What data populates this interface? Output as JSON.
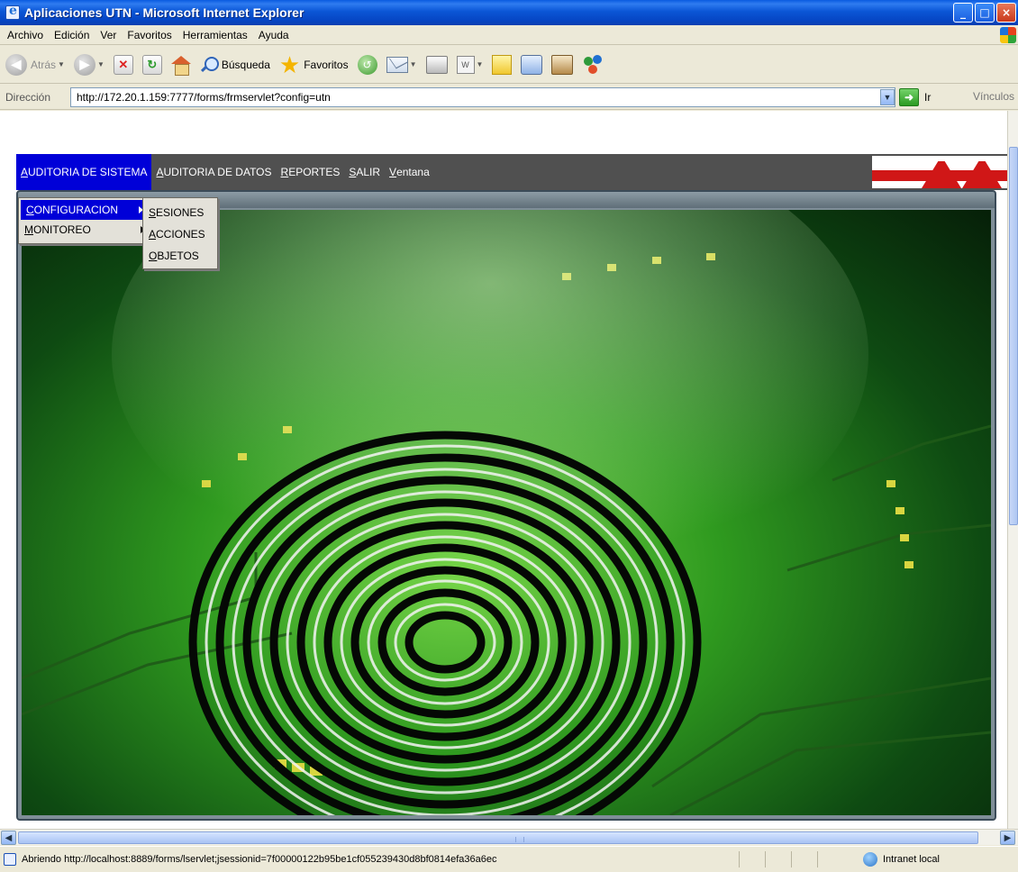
{
  "window": {
    "title": "Aplicaciones UTN - Microsoft Internet Explorer",
    "controls": {
      "minimize": "_",
      "maximize": "□",
      "close": "×"
    }
  },
  "menubar": {
    "items": [
      "Archivo",
      "Edición",
      "Ver",
      "Favoritos",
      "Herramientas",
      "Ayuda"
    ]
  },
  "toolbar": {
    "back_label": "Atrás",
    "search_label": "Búsqueda",
    "favorites_label": "Favoritos",
    "icons": [
      "back-icon",
      "forward-icon",
      "stop-icon",
      "refresh-icon",
      "home-icon",
      "search-icon",
      "favorites-star-icon",
      "media-icon",
      "mail-icon",
      "print-icon",
      "edit-icon",
      "notes-icon",
      "messenger-icon",
      "research-icon",
      "contacts-icon"
    ]
  },
  "address": {
    "label": "Dirección",
    "url": "http://172.20.1.159:7777/forms/frmservlet?config=utn",
    "go_label": "Ir",
    "links_label": "Vínculos"
  },
  "app_menu": {
    "items": [
      {
        "label": "AUDITORIA DE SISTEMA",
        "accel": "A",
        "rest": "UDITORIA DE SISTEMA"
      },
      {
        "label": "AUDITORIA DE DATOS",
        "accel": "A",
        "rest": "UDITORIA DE DATOS"
      },
      {
        "label": "REPORTES",
        "accel": "R",
        "rest": "EPORTES"
      },
      {
        "label": "SALIR",
        "accel": "S",
        "rest": "ALIR"
      },
      {
        "label": "Ventana",
        "accel": "V",
        "rest": "entana"
      }
    ],
    "submenu": [
      {
        "label": "CONFIGURACION",
        "accel": "C",
        "rest": "ONFIGURACION"
      },
      {
        "label": "MONITOREO",
        "accel": "M",
        "rest": "ONITOREO"
      }
    ],
    "subsubmenu": [
      {
        "label": "SESIONES",
        "accel": "S",
        "rest": "ESIONES"
      },
      {
        "label": "ACCIONES",
        "accel": "A",
        "rest": "CCIONES"
      },
      {
        "label": "OBJETOS",
        "accel": "O",
        "rest": "BJETOS"
      }
    ]
  },
  "statusbar": {
    "text": "Abriendo http://localhost:8889/forms/lservlet;jsessionid=7f00000122b95be1cf055239430d8bf0814efa36a6ec",
    "zone": "Intranet local"
  },
  "colors": {
    "menu_bar_bg": "#505050",
    "menu_active_bg": "#0000d8",
    "logo_red": "#d01717"
  }
}
